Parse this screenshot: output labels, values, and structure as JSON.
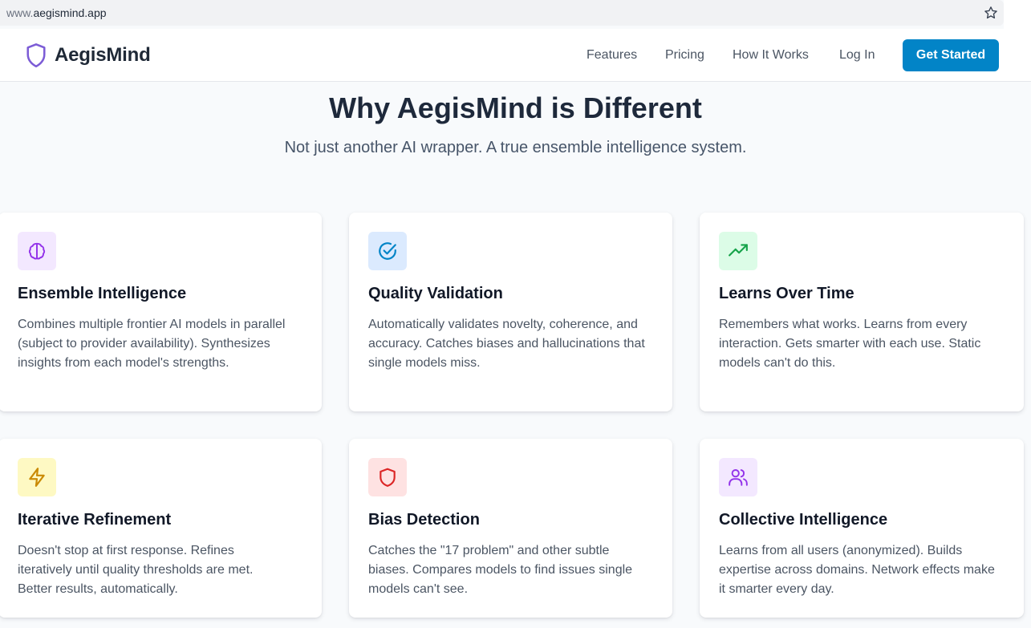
{
  "browser": {
    "url_prefix": "www.",
    "url_domain": "aegismind.app",
    "bookmark_icon": "star-icon"
  },
  "nav": {
    "brand_icon": "shield-icon",
    "brand_name": "AegisMind",
    "links": [
      "Features",
      "Pricing",
      "How It Works",
      "Log In"
    ],
    "cta_label": "Get Started"
  },
  "hero": {
    "title": "Why AegisMind is Different",
    "subtitle": "Not just another AI wrapper. A true ensemble intelligence system."
  },
  "features": [
    {
      "icon": "brain-icon",
      "title": "Ensemble Intelligence",
      "description": "Combines multiple frontier AI models in parallel (subject to provider availability). Synthesizes insights from each model's strengths.",
      "icon_bg": "#f3e8ff",
      "icon_color": "#9333ea"
    },
    {
      "icon": "check-circle-icon",
      "title": "Quality Validation",
      "description": "Automatically validates novelty, coherence, and accuracy. Catches biases and hallucinations that single models miss.",
      "icon_bg": "#dbeafe",
      "icon_color": "#0284c7"
    },
    {
      "icon": "trending-up-icon",
      "title": "Learns Over Time",
      "description": "Remembers what works. Learns from every interaction. Gets smarter with each use. Static models can't do this.",
      "icon_bg": "#dcfce7",
      "icon_color": "#16a34a"
    },
    {
      "icon": "lightning-icon",
      "title": "Iterative Refinement",
      "description": "Doesn't stop at first response. Refines iteratively until quality thresholds are met. Better results, automatically.",
      "icon_bg": "#fef9c3",
      "icon_color": "#ca8a04"
    },
    {
      "icon": "shield-icon",
      "title": "Bias Detection",
      "description": "Catches the \"17 problem\" and other subtle biases. Compares models to find issues single models can't see.",
      "icon_bg": "#fee2e2",
      "icon_color": "#dc2626"
    },
    {
      "icon": "users-icon",
      "title": "Collective Intelligence",
      "description": "Learns from all users (anonymized). Builds expertise across domains. Network effects make it smarter every day.",
      "icon_bg": "#f3e8ff",
      "icon_color": "#9333ea"
    }
  ],
  "colors": {
    "brand": "#7c5cd6",
    "cta": "#0284c7",
    "page_bg": "#f8fafc"
  }
}
